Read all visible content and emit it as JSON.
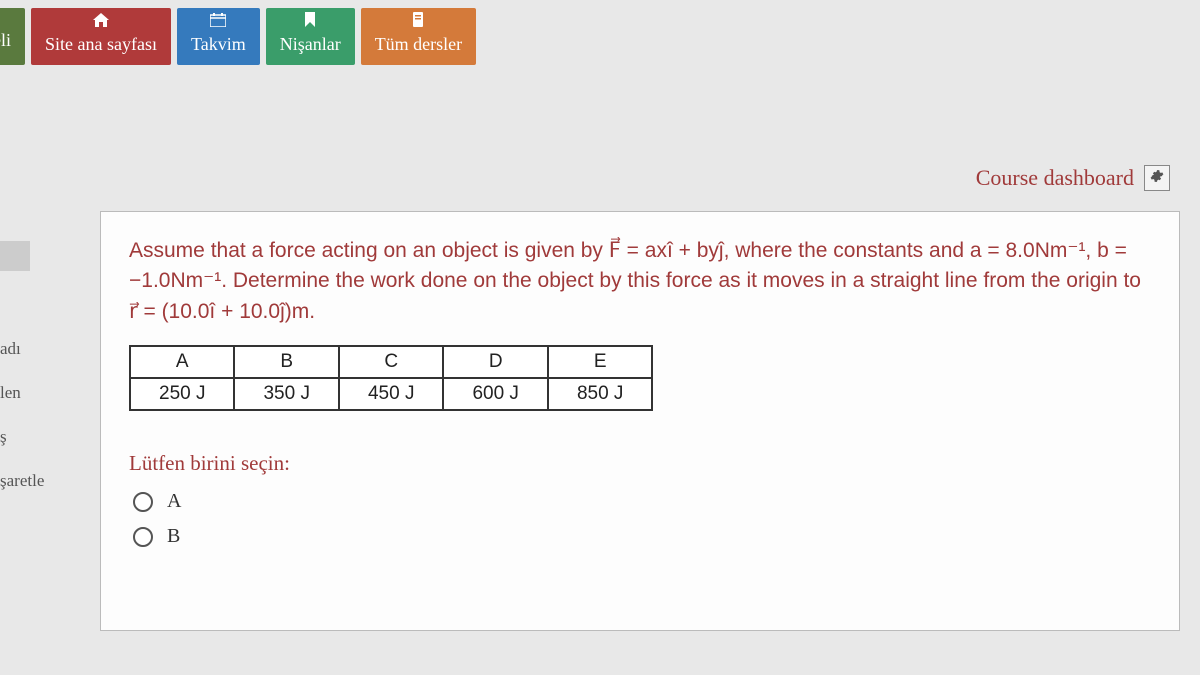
{
  "nav": {
    "neli": "neli",
    "home": "Site ana sayfası",
    "calendar": "Takvim",
    "bookmarks": "Nişanlar",
    "allcourses": "Tüm dersler"
  },
  "dashboard": "Course dashboard",
  "sidebar": {
    "item1": "adı",
    "item2": "len",
    "item3": "ş",
    "item4": "şaretle"
  },
  "question": {
    "text": "Assume that a force acting on an object is given by F⃗ = axî + byĵ, where the constants and a = 8.0Nm⁻¹, b = −1.0Nm⁻¹. Determine the work done on the object by this force as it moves in a straight line from the origin to r⃗ = (10.0î + 10.0ĵ)m."
  },
  "table": {
    "headers": [
      "A",
      "B",
      "C",
      "D",
      "E"
    ],
    "values": [
      "250 J",
      "350 J",
      "450 J",
      "600 J",
      "850 J"
    ]
  },
  "choose": "Lütfen birini seçin:",
  "options": {
    "a": "A",
    "b": "B"
  }
}
